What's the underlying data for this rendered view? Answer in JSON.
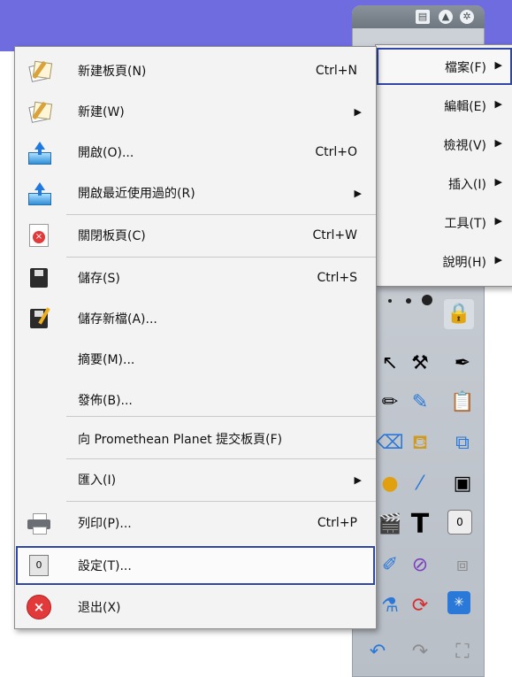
{
  "menu": {
    "items": [
      {
        "label": "新建板頁(N)",
        "shortcut": "Ctrl+N",
        "icon": "new-flipchart-icon"
      },
      {
        "label": "新建(W)",
        "submenu": true,
        "icon": "new-icon"
      },
      {
        "label": "開啟(O)...",
        "shortcut": "Ctrl+O",
        "icon": "open-icon"
      },
      {
        "label": "開啟最近使用過的(R)",
        "submenu": true,
        "icon": "open-recent-icon"
      },
      {
        "label": "關閉板頁(C)",
        "shortcut": "Ctrl+W",
        "icon": "close-flipchart-icon"
      },
      {
        "label": "儲存(S)",
        "shortcut": "Ctrl+S",
        "icon": "save-icon"
      },
      {
        "label": "儲存新檔(A)...",
        "icon": "save-as-icon"
      },
      {
        "label": "摘要(M)..."
      },
      {
        "label": "發佈(B)..."
      },
      {
        "label": "向 Promethean Planet 提交板頁(F)"
      },
      {
        "label": "匯入(I)",
        "submenu": true
      },
      {
        "label": "列印(P)...",
        "shortcut": "Ctrl+P",
        "icon": "printer-icon"
      },
      {
        "label": "設定(T)...",
        "icon": "settings-icon",
        "selected": true
      },
      {
        "label": "退出(X)",
        "icon": "exit-icon"
      }
    ],
    "submenu_arrow": "▶"
  },
  "submenu": {
    "items": [
      {
        "label": "檔案(F)",
        "selected": true
      },
      {
        "label": "編輯(E)"
      },
      {
        "label": "檢視(V)"
      },
      {
        "label": "插入(I)"
      },
      {
        "label": "工具(T)"
      },
      {
        "label": "說明(H)"
      }
    ]
  },
  "toolbox": {
    "title_buttons": [
      "document-icon",
      "up-arrow-icon",
      "gear-icon"
    ],
    "tools": [
      "pointer-icon",
      "tools-icon",
      "pen-icon",
      "highlighter-icon",
      "clipboard-icon",
      "eraser-icon",
      "fill-icon",
      "paste-icon",
      "syringe-icon",
      "save-icon",
      "text-icon",
      "settings-icon",
      "magic-pen-icon",
      "layers-icon",
      "refresh-icon",
      "grid-icon",
      "undo-icon",
      "redo-icon",
      "screenshot-icon"
    ],
    "text_tool_glyph": "T",
    "settings_glyph": "0"
  },
  "colors": {
    "top_bar": "#6f6ce0",
    "menu_bg": "#f3f3f3",
    "selection_border": "#3147a8"
  }
}
